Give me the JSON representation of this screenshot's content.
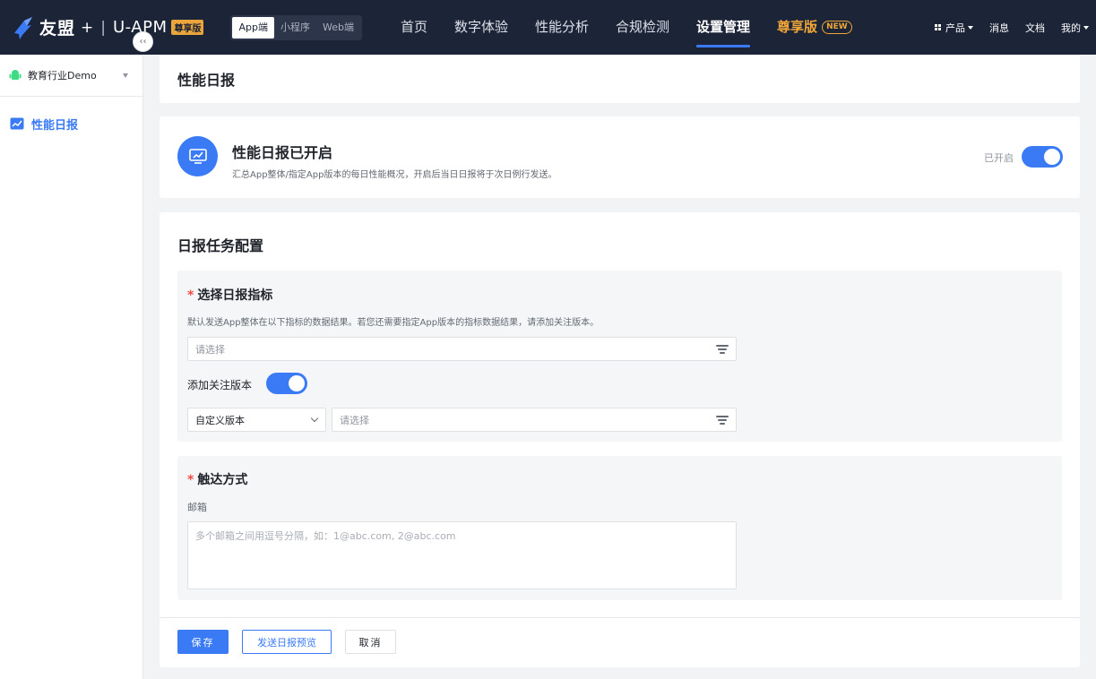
{
  "brand": {
    "name": "友盟",
    "plus": "+",
    "separator": "|",
    "product": "U-APM",
    "badge": "尊享版"
  },
  "platforms": [
    {
      "label": "App端",
      "active": true
    },
    {
      "label": "小程序",
      "active": false
    },
    {
      "label": "Web端",
      "active": false
    }
  ],
  "nav": {
    "items": [
      "首页",
      "数字体验",
      "性能分析",
      "合规检测",
      "设置管理"
    ],
    "active": "设置管理",
    "premium_label": "尊享版",
    "new_tag": "NEW"
  },
  "right_nav": {
    "products": "产品",
    "messages": "消息",
    "docs": "文档",
    "mine": "我的"
  },
  "sidebar": {
    "app_name": "教育行业Demo",
    "collapse_glyph": "‹‹",
    "items": [
      {
        "label": "性能日报",
        "icon": "chart-trend-icon",
        "active": true
      }
    ]
  },
  "page": {
    "title": "性能日报"
  },
  "status": {
    "title": "性能日报已开启",
    "description": "汇总App整体/指定App版本的每日性能概况，开启后当日日报将于次日例行发送。",
    "switch_label": "已开启",
    "enabled": true
  },
  "config": {
    "title": "日报任务配置",
    "metric": {
      "required_mark": "*",
      "title": "选择日报指标",
      "description": "默认发送App整体在以下指标的数据结果。若您还需要指定App版本的指标数据结果，请添加关注版本。",
      "select_placeholder": "请选择",
      "version_label": "添加关注版本",
      "version_enabled": true,
      "version_type": "自定义版本",
      "version_placeholder": "请选择"
    },
    "reach": {
      "required_mark": "*",
      "title": "触达方式",
      "email_label": "邮箱",
      "email_placeholder": "多个邮箱之间用逗号分隔，如：1@abc.com, 2@abc.com"
    }
  },
  "buttons": {
    "save": "保存",
    "preview": "发送日报预览",
    "cancel": "取消"
  },
  "colors": {
    "topbar": "#1c2438",
    "accent": "#3a7bf5",
    "premium": "#f1a637",
    "background": "#f2f3f5"
  }
}
